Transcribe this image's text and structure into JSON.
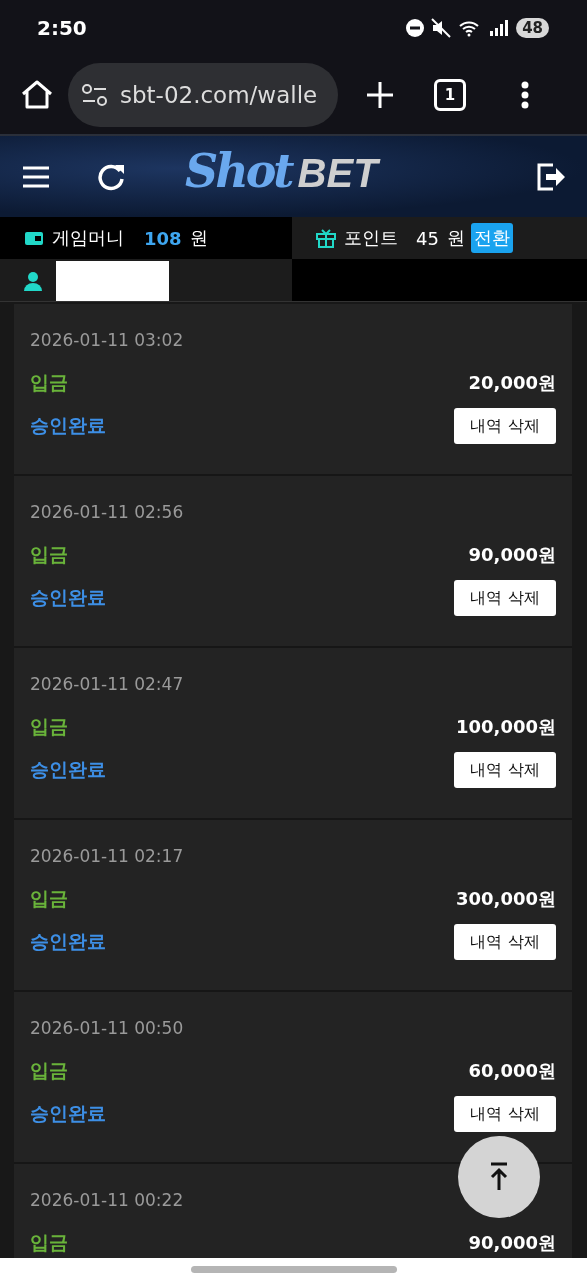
{
  "status_bar": {
    "time": "2:50",
    "battery": "48"
  },
  "browser": {
    "url": "sbt-02.com/walle",
    "tab_count": "1"
  },
  "logo": {
    "part_1": "Shot",
    "part_2": "BET"
  },
  "wallet": {
    "money_label": "게임머니",
    "money_value": "108",
    "money_unit": "원",
    "points_label": "포인트",
    "points_value": "45",
    "points_unit": "원",
    "convert_button": "전환"
  },
  "history": [
    {
      "date": "2026-01-11 03:02",
      "type": "입금",
      "amount": "20,000원",
      "status": "승인완료",
      "button": "내역 삭제"
    },
    {
      "date": "2026-01-11 02:56",
      "type": "입금",
      "amount": "90,000원",
      "status": "승인완료",
      "button": "내역 삭제"
    },
    {
      "date": "2026-01-11 02:47",
      "type": "입금",
      "amount": "100,000원",
      "status": "승인완료",
      "button": "내역 삭제"
    },
    {
      "date": "2026-01-11 02:17",
      "type": "입금",
      "amount": "300,000원",
      "status": "승인완료",
      "button": "내역 삭제"
    },
    {
      "date": "2026-01-11 00:50",
      "type": "입금",
      "amount": "60,000원",
      "status": "승인완료",
      "button": "내역 삭제"
    },
    {
      "date": "2026-01-11 00:22",
      "type": "입금",
      "amount": "90,000원"
    }
  ]
}
